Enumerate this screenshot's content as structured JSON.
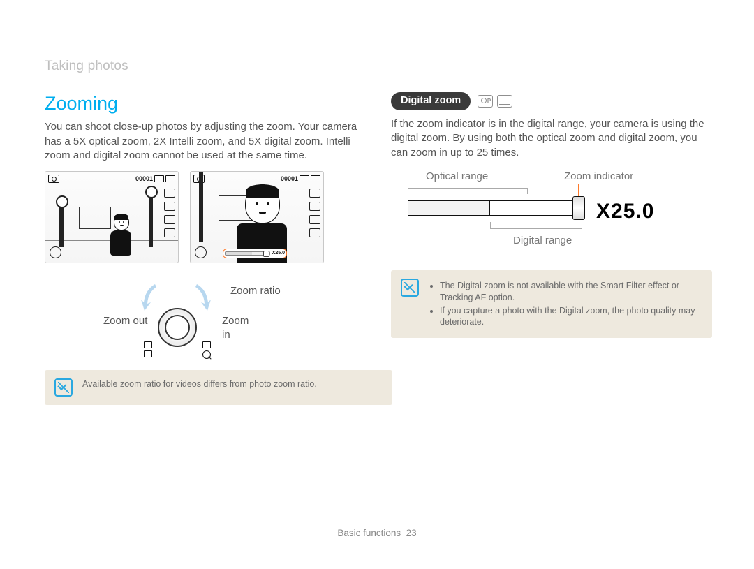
{
  "breadcrumb": "Taking photos",
  "left": {
    "title": "Zooming",
    "body": "You can shoot close-up photos by adjusting the zoom. Your camera has a 5X optical zoom, 2X Intelli zoom, and 5X digital zoom. Intelli zoom and digital zoom cannot be used at the same time.",
    "screen_counter": "00001",
    "zoom_bar_label": "X25.0",
    "zoom_ratio_label": "Zoom ratio",
    "zoom_out": "Zoom out",
    "zoom_in": "Zoom in",
    "note": "Available zoom ratio for videos differs from photo zoom ratio."
  },
  "right": {
    "pill": "Digital zoom",
    "body": "If the zoom indicator is in the digital range, your camera is using the digital zoom. By using both the optical zoom and digital zoom, you can zoom in up to 25 times.",
    "optical_label": "Optical range",
    "indicator_label": "Zoom indicator",
    "digital_label": "Digital range",
    "zoom_value": "X25.0",
    "notes": [
      "The Digital zoom is not available with the Smart Filter effect or Tracking AF option.",
      "If you capture a photo with the Digital zoom, the photo quality may deteriorate."
    ]
  },
  "footer": {
    "section": "Basic functions",
    "page": "23"
  }
}
